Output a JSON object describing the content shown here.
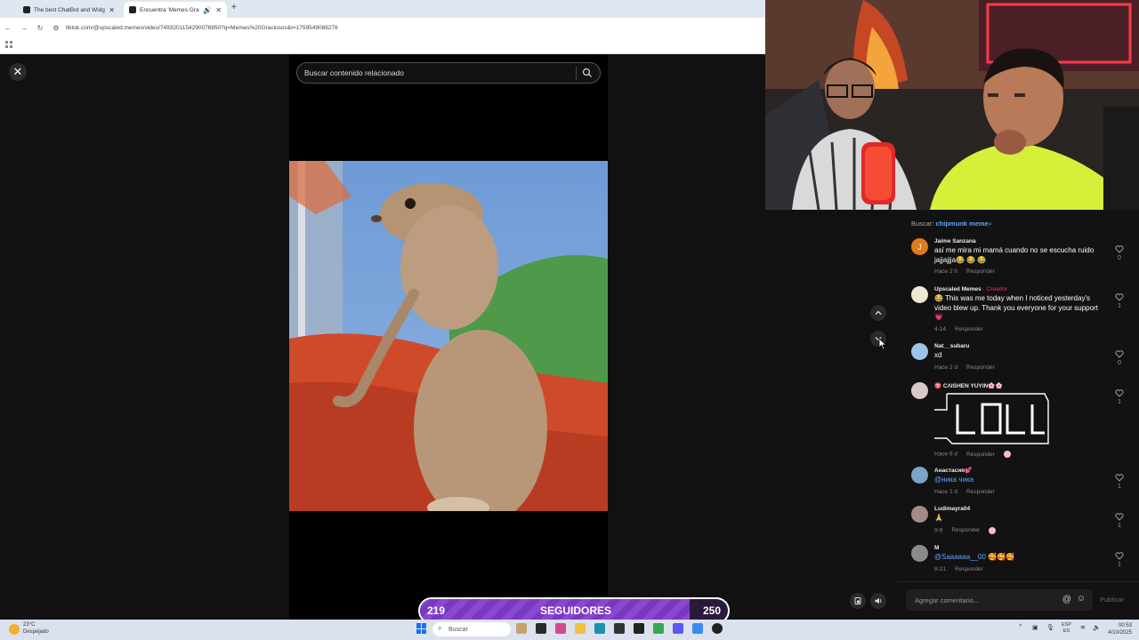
{
  "browser": {
    "tabs": [
      {
        "title": "The best ChatBot and Widgets"
      },
      {
        "title": "Encuentra 'Memes Graciosos'"
      }
    ],
    "url": "tiktok.com/@upscaled.memes/video/7493201154290076950?q=Memes%20Graciosos&t=1759549086276"
  },
  "viewer": {
    "search_placeholder": "Buscar contenido relacionado"
  },
  "comments_panel": {
    "search_prefix": "Buscar: ",
    "search_term": "chipmunk meme",
    "reply_label": "Responder",
    "items": [
      {
        "user": "Jaime Sanzana",
        "text": "así me mira mi mamá cuando no se escucha ruido jajjajjja😂 😂 😂",
        "time": "Hace 2 h",
        "likes": "0"
      },
      {
        "user": "Upscaled Memes",
        "creator": "· Creador",
        "text": "😂 This was me today when I noticed yesterday's video blew up. Thank you everyone for your support 💗",
        "time": "4-14",
        "likes": "1"
      },
      {
        "user": "Nat__subaru",
        "text": "xd",
        "time": "Hace 2 d",
        "likes": "0"
      },
      {
        "user": "♈ CΛISHEN YUYIN🌸🌸",
        "text": "",
        "time": "Hace 6 d",
        "likes": "1"
      },
      {
        "user": "Анастасия💕",
        "mention": "@ника чика",
        "time": "Hace 1 d",
        "likes": "1"
      },
      {
        "user": "Ludimayra04",
        "text": "🙏",
        "time": "9-9",
        "likes": "1"
      },
      {
        "user": "M",
        "mention": "@Saaaaaa__00",
        "text": "🥰🥰🥰",
        "time": "8-21",
        "likes": "1"
      }
    ],
    "input_placeholder": "Agregar comentario...",
    "publish_label": "Publicar"
  },
  "follower_goal": {
    "current": "219",
    "label": "SEGUIDORES",
    "target": "250",
    "progress": 0.876
  },
  "taskbar": {
    "temp": "23°C",
    "weather": "Despejado",
    "search_label": "Buscar",
    "lang_top": "ESP",
    "lang_bottom": "ES",
    "time": "00:53",
    "date": "4/10/2025"
  },
  "colors": {
    "accent_blue": "#5ea4ff",
    "creator_red": "#fe2c55",
    "goal_purple": "#8a48d0"
  }
}
